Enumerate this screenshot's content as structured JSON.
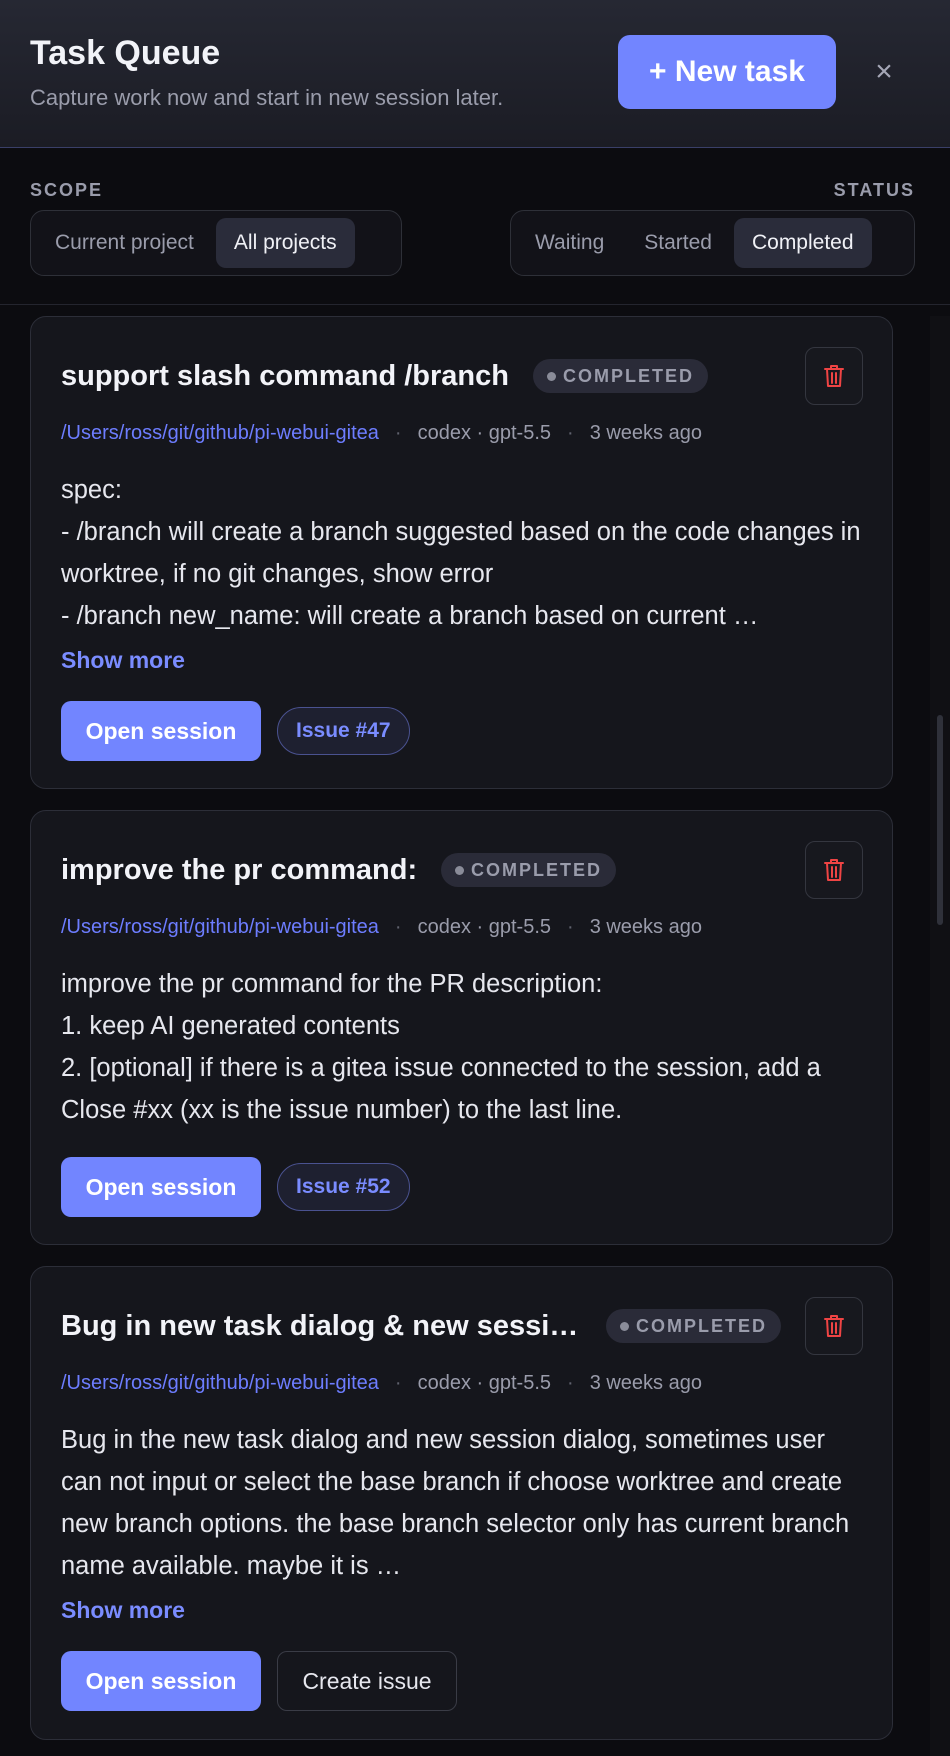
{
  "header": {
    "title": "Task Queue",
    "subtitle": "Capture work now and start in new session later.",
    "new_task_label": "+ New task",
    "close_label": "×"
  },
  "filters": {
    "scope_label": "SCOPE",
    "scope_options": [
      "Current project",
      "All projects"
    ],
    "scope_selected": "All projects",
    "status_label": "STATUS",
    "status_options": [
      "Waiting",
      "Started",
      "Completed"
    ],
    "status_selected": "Completed"
  },
  "tasks": [
    {
      "title": "support slash command /branch",
      "status": "COMPLETED",
      "path": "/Users/ross/git/github/pi-webui-gitea",
      "model": "codex · gpt-5.5",
      "time": "3 weeks ago",
      "body": "spec:\n- /branch will create a branch suggested based on the code changes in worktree, if no git changes, show error\n- /branch new_name:  will create a branch based on current …",
      "show_more": "Show more",
      "open_label": "Open session",
      "issue_label": "Issue #47"
    },
    {
      "title": "improve the pr command:",
      "status": "COMPLETED",
      "path": "/Users/ross/git/github/pi-webui-gitea",
      "model": "codex · gpt-5.5",
      "time": "3 weeks ago",
      "body": "improve the pr command for the PR description:\n1. keep AI generated contents\n2. [optional] if there is a gitea issue connected to the session, add a Close #xx (xx is the issue number) to the last line.",
      "open_label": "Open session",
      "issue_label": "Issue #52"
    },
    {
      "title": "Bug in new task dialog & new sessi…",
      "status": "COMPLETED",
      "path": "/Users/ross/git/github/pi-webui-gitea",
      "model": "codex · gpt-5.5",
      "time": "3 weeks ago",
      "body": "Bug in the new task dialog and new session dialog, sometimes user can not input or select the base branch if choose worktree and create new branch options. the base branch selector only has current branch name available. maybe it is …",
      "show_more": "Show more",
      "open_label": "Open session",
      "create_issue_label": "Create issue"
    }
  ],
  "colors": {
    "accent": "#7285ff",
    "link": "#6d7dff",
    "danger": "#ef4444",
    "background": "#0c0c10",
    "card": "#15161c"
  }
}
